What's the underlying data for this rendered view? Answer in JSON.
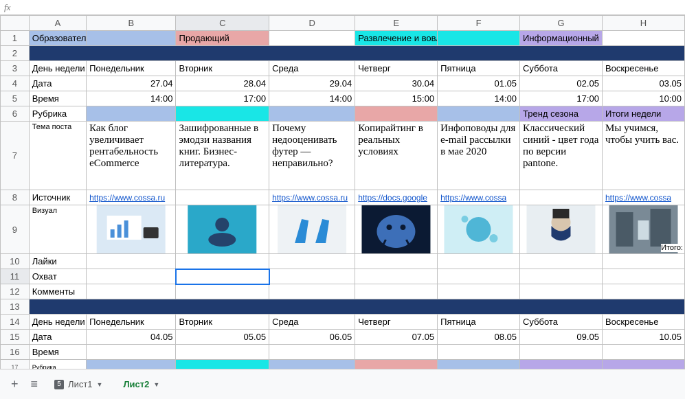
{
  "fx_label": "fx",
  "columns": [
    "A",
    "B",
    "C",
    "D",
    "E",
    "F",
    "G",
    "H"
  ],
  "rows": [
    "1",
    "2",
    "3",
    "4",
    "5",
    "6",
    "7",
    "8",
    "9",
    "10",
    "11",
    "12",
    "13",
    "14",
    "15",
    "16",
    "17"
  ],
  "categories": {
    "a1": "Образовательный пост",
    "c1": "Продающий",
    "e1": "Развлечение и вовлечение",
    "g1": "Информационный"
  },
  "labels": {
    "day": "День недели",
    "date": "Дата",
    "time": "Время",
    "rubric": "Рубрика",
    "topic": "Тема поста",
    "source": "Источник",
    "visual": "Визуал",
    "likes": "Лайки",
    "reach": "Охват",
    "comments": "Комменты",
    "total": "Итого:"
  },
  "days": {
    "mon": "Понедельник",
    "tue": "Вторник",
    "wed": "Среда",
    "thu": "Четверг",
    "fri": "Пятница",
    "sat": "Суббота",
    "sun": "Воскресенье"
  },
  "week1": {
    "dates": {
      "mon": "27.04",
      "tue": "28.04",
      "wed": "29.04",
      "thu": "30.04",
      "fri": "01.05",
      "sat": "02.05",
      "sun": "03.05"
    },
    "times": {
      "mon": "14:00",
      "tue": "17:00",
      "wed": "14:00",
      "thu": "15:00",
      "fri": "14:00",
      "sat": "17:00",
      "sun": "10:00"
    },
    "rubric": {
      "sat": "Тренд сезона",
      "sun": "Итоги недели"
    },
    "topics": {
      "mon": "Как блог увеличивает рентабельность eCommerce",
      "tue": "Зашифрованные в эмодзи названия книг. Бизнес-литература.",
      "wed": "Почему недооценивать футер — неправильно?",
      "thu": "Копирайтинг в реальных условиях",
      "fri": "Инфоповоды для e-mail рассылки в мае 2020",
      "sat": "Классический синий - цвет года по версии pantone.",
      "sun": "Мы учимся, чтобы учить вас."
    },
    "sources": {
      "mon": "https://www.cossa.ru",
      "wed": "https://www.cossa.ru",
      "thu": "https://docs.google",
      "fri": "https://www.cossa",
      "sun": "https://www.cossa"
    }
  },
  "week2": {
    "dates": {
      "mon": "04.05",
      "tue": "05.05",
      "wed": "06.05",
      "thu": "07.05",
      "fri": "08.05",
      "sat": "09.05",
      "sun": "10.05"
    }
  },
  "colors": {
    "edu": "#a7c0e8",
    "sell": "#e8a7a7",
    "fun": "#19e6e6",
    "info": "#b7a7e8",
    "darkbar": "#1f3a6e"
  },
  "tabs": {
    "add": "+",
    "menu": "≡",
    "sheet1": "Лист1",
    "sheet2": "Лист2",
    "badge1": "5"
  }
}
